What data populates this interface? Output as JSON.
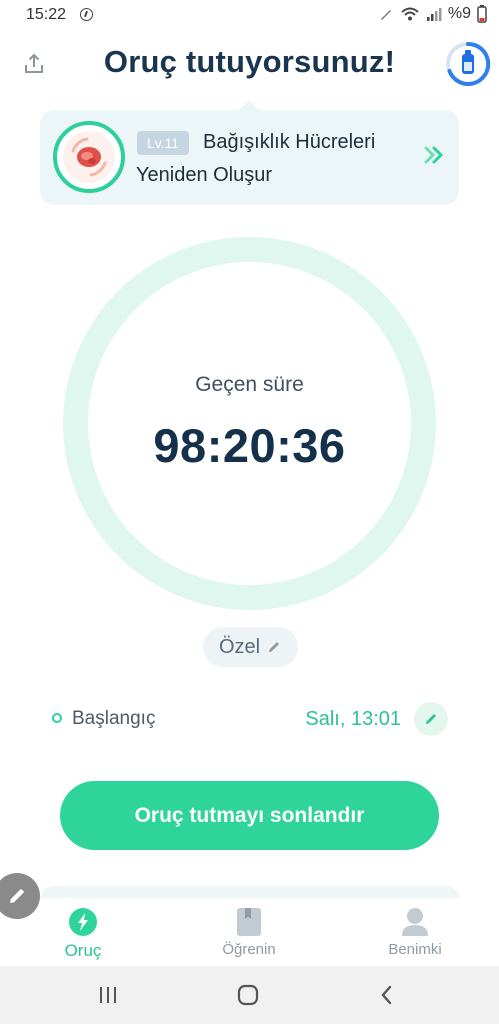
{
  "status_bar": {
    "time": "15:22",
    "battery_text": "%9"
  },
  "header": {
    "title": "Oruç tutuyorsunuz!",
    "share_icon": "share-icon",
    "progress_icon": "fasting-progress-icon"
  },
  "banner": {
    "level": "Lv.11",
    "line1": "Bağışıklık Hücreleri",
    "line2": "Yeniden Oluşur",
    "avatar_icon": "immune-cell-icon",
    "arrow_icon": "double-chevron-right-icon"
  },
  "timer": {
    "label": "Geçen süre",
    "elapsed": "98:20:36"
  },
  "plan": {
    "label": "Özel"
  },
  "start": {
    "label": "Başlangıç",
    "value": "Salı, 13:01"
  },
  "actions": {
    "end_fast": "Oruç tutmayı sonlandır"
  },
  "bottom_nav": {
    "items": [
      {
        "label": "Oruç",
        "icon": "lightning-icon",
        "active": true
      },
      {
        "label": "Öğrenin",
        "icon": "bookmark-icon",
        "active": false
      },
      {
        "label": "Benimki",
        "icon": "profile-icon",
        "active": false
      }
    ]
  },
  "colors": {
    "accent": "#2fd49a",
    "title": "#1a3550",
    "ring": "#dff7ee",
    "banner_bg": "#ecf6f8"
  }
}
